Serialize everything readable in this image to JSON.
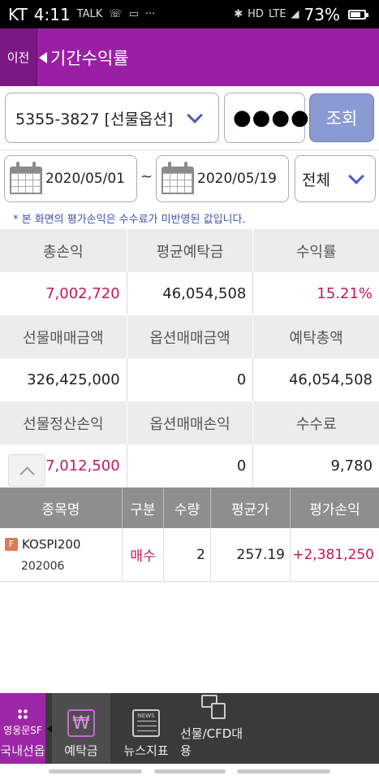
{
  "status_bar": {
    "carrier": "KT",
    "time": "4:11",
    "left_icons": [
      "talk-icon",
      "phone-icon",
      "message-icon",
      "more-icon"
    ],
    "network": "LTE",
    "battery_percent": "73%",
    "battery_level": 0.73
  },
  "header": {
    "back_label": "이전",
    "title": "기간수익률"
  },
  "query": {
    "account_value": "5355-3827 [선물옵션]",
    "password_value": "●●●●",
    "search_label": "조회"
  },
  "date_filter": {
    "start_date": "2020/05/01",
    "separator": "~",
    "end_date": "2020/05/19",
    "period_value": "전체",
    "notice": "* 본 화면의 평가손익은 수수료가 미반영된 값입니다."
  },
  "summary": {
    "row1": {
      "headers": [
        "총손익",
        "평균예탁금",
        "수익률"
      ],
      "values": [
        "7,002,720",
        "46,054,508",
        "15.21%"
      ]
    },
    "row2": {
      "headers": [
        "선물매매금액",
        "옵션매매금액",
        "예탁총액"
      ],
      "values": [
        "326,425,000",
        "0",
        "46,054,508"
      ]
    },
    "row3": {
      "headers": [
        "선물정산손익",
        "옵션매매손익",
        "수수료"
      ],
      "values": [
        "7,012,500",
        "0",
        "9,780"
      ]
    }
  },
  "holdings": {
    "columns": [
      "종목명",
      "구분",
      "수량",
      "평균가",
      "평가손익"
    ],
    "rows": [
      {
        "badge": "F",
        "name": "KOSPI200",
        "code": "202006",
        "type": "매수",
        "qty": "2",
        "avg_price": "257.19",
        "eval_pl": "+2,381,250"
      }
    ]
  },
  "bottom_nav": {
    "menu_brand": "영웅문SF",
    "menu_label": "국내선옵",
    "items": [
      {
        "label": "예탁금",
        "icon": "won-icon"
      },
      {
        "label": "뉴스지표",
        "icon": "news-icon",
        "icon_text": "NEWS"
      },
      {
        "label": "선물/CFD대용",
        "icon": "document-icon"
      }
    ]
  },
  "colors": {
    "brand_purple": "#9b1fa5",
    "positive": "#c2185b",
    "accent_blue": "#4a5bbd"
  }
}
